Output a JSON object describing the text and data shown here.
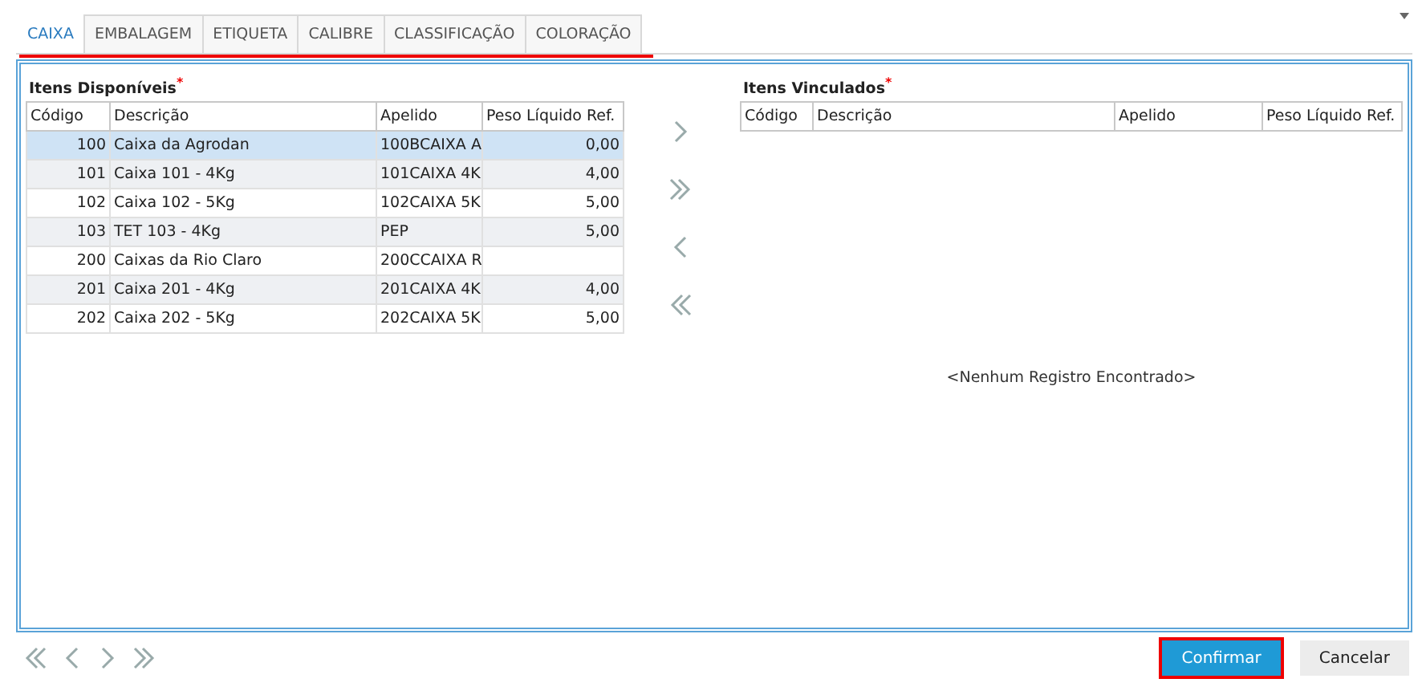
{
  "tabs": [
    {
      "label": "CAIXA",
      "selected": true
    },
    {
      "label": "EMBALAGEM",
      "selected": false
    },
    {
      "label": "ETIQUETA",
      "selected": false
    },
    {
      "label": "CALIBRE",
      "selected": false
    },
    {
      "label": "CLASSIFICAÇÃO",
      "selected": false
    },
    {
      "label": "COLORAÇÃO",
      "selected": false
    }
  ],
  "available": {
    "title": "Itens Disponíveis",
    "required_mark": "*",
    "columns": [
      "Código",
      "Descrição",
      "Apelido",
      "Peso Líquido Ref."
    ],
    "rows": [
      {
        "cells": [
          "100",
          "Caixa da Agrodan",
          "100BCAIXA A",
          "0,00"
        ],
        "selected": true
      },
      {
        "cells": [
          "101",
          "Caixa 101 - 4Kg",
          "101CAIXA 4K",
          "4,00"
        ],
        "selected": false
      },
      {
        "cells": [
          "102",
          "Caixa 102 - 5Kg",
          "102CAIXA 5K",
          "5,00"
        ],
        "selected": false
      },
      {
        "cells": [
          "103",
          "TET 103 - 4Kg",
          "PEP",
          "5,00"
        ],
        "selected": false
      },
      {
        "cells": [
          "200",
          "Caixas da Rio Claro",
          "200CCAIXA R",
          ""
        ],
        "selected": false
      },
      {
        "cells": [
          "201",
          "Caixa 201 - 4Kg",
          "201CAIXA 4K",
          "4,00"
        ],
        "selected": false
      },
      {
        "cells": [
          "202",
          "Caixa 202 - 5Kg",
          "202CAIXA 5K",
          "5,00"
        ],
        "selected": false
      }
    ]
  },
  "linked": {
    "title": "Itens Vinculados",
    "required_mark": "*",
    "columns": [
      "Código",
      "Descrição",
      "Apelido",
      "Peso Líquido Ref."
    ],
    "empty_message": "<Nenhum Registro Encontrado>"
  },
  "buttons": [
    {
      "label": "Confirmar",
      "kind": "primary"
    },
    {
      "label": "Cancelar",
      "kind": "secondary"
    }
  ]
}
